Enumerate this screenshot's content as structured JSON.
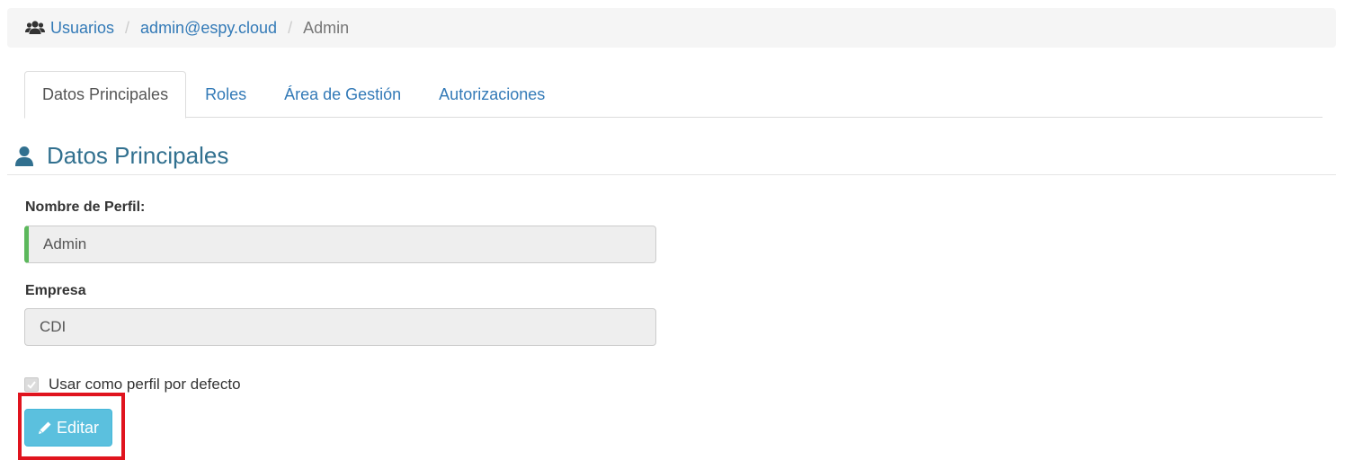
{
  "breadcrumb": {
    "icon": "users-icon",
    "items": [
      "Usuarios",
      "admin@espy.cloud"
    ],
    "separator": "/",
    "current": "Admin"
  },
  "tabs": [
    {
      "label": "Datos Principales",
      "active": true
    },
    {
      "label": "Roles",
      "active": false
    },
    {
      "label": "Área de Gestión",
      "active": false
    },
    {
      "label": "Autorizaciones",
      "active": false
    }
  ],
  "section": {
    "icon": "user-icon",
    "title": "Datos Principales"
  },
  "form": {
    "profile_name_label": "Nombre de Perfil:",
    "profile_name_value": "Admin",
    "company_label": "Empresa",
    "company_value": "CDI",
    "default_checkbox_label": "Usar como perfil por defecto",
    "default_checked": true
  },
  "actions": {
    "edit_label": "Editar",
    "edit_icon": "pencil-icon"
  },
  "colors": {
    "link": "#337ab7",
    "section_title": "#31708f",
    "edit_button": "#5bc0de",
    "valid_border": "#5cb85c",
    "highlight": "#e0141e"
  }
}
